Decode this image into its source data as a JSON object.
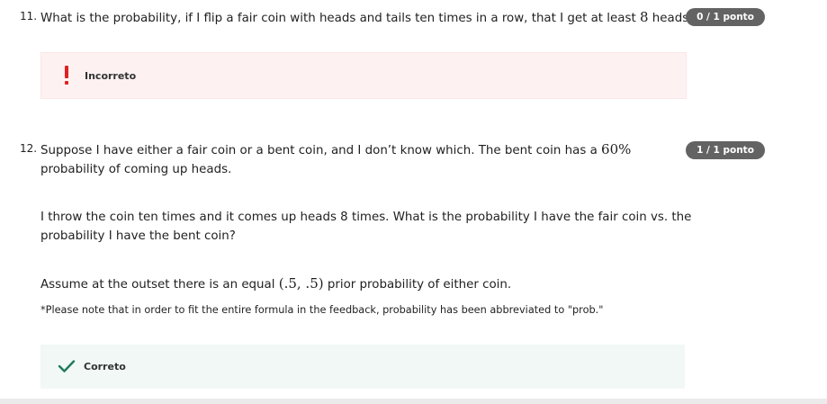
{
  "q11": {
    "number": "11.",
    "text_a": "What is the probability, if I flip a fair coin with heads and tails ten times in a row, that I get at least ",
    "text_math": "8",
    "text_b": " heads?",
    "score": "0 / 1 ponto",
    "feedback_icon": "exclamation-icon",
    "feedback_label": "Incorreto",
    "feedback_color": "#e02020"
  },
  "q12": {
    "number": "12.",
    "p1_a": "Suppose I have either a fair coin or a bent coin, and I don’t know which. The bent coin has a ",
    "p1_math": "60%",
    "p1_b": "probability of coming up heads.",
    "p2_a": "I throw the coin ten times and it comes up heads 8 times. What is the probability I have the fair coin vs. the",
    "p2_b": "probability I have the bent coin?",
    "p3_a": "Assume at the outset there is an equal ",
    "p3_math": "(.5, .5)",
    "p3_b": " prior probability of either coin.",
    "note": "*Please note that in order to fit the entire formula in the feedback, probability has been abbreviated to \"prob.\"",
    "score": "1 / 1 ponto",
    "feedback_icon": "checkmark-icon",
    "feedback_label": "Correto",
    "feedback_color": "#1f7a5c"
  }
}
